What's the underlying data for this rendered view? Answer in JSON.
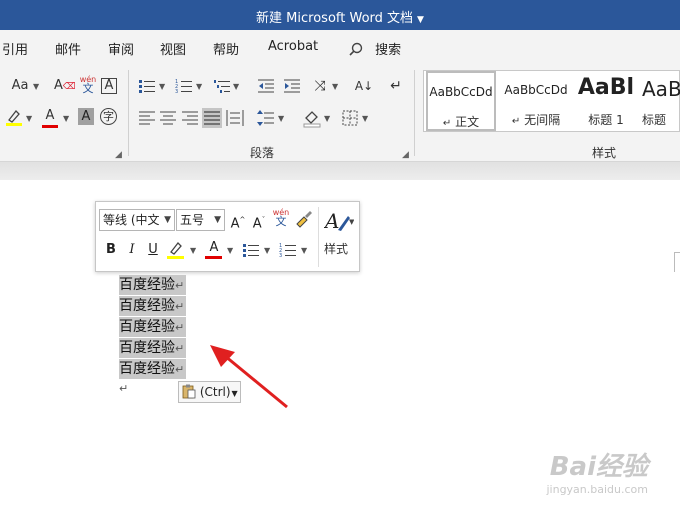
{
  "window": {
    "title": "新建 Microsoft Word 文档"
  },
  "menu": [
    "引用",
    "邮件",
    "审阅",
    "视图",
    "帮助",
    "Acrobat"
  ],
  "search": {
    "label": "搜索"
  },
  "ribbon": {
    "font_size_label": "Aa",
    "phonetic": {
      "top": "wén",
      "bottom": "文"
    },
    "groups": {
      "paragraph": "段落",
      "styles": "样式"
    },
    "styles": [
      {
        "sample": "AaBbCcDd",
        "name": "正文",
        "marker": "↵"
      },
      {
        "sample": "AaBbCcDd",
        "name": "无间隔",
        "marker": "↵"
      },
      {
        "sample": "AaBl",
        "name": "标题 1"
      },
      {
        "sample": "AaB",
        "name": "标题"
      }
    ]
  },
  "mini_toolbar": {
    "font_name": "等线 (中文",
    "font_size": "五号",
    "bold": "B",
    "italic": "I",
    "underline": "U",
    "styles_label": "样式",
    "phonetic": {
      "top": "wén",
      "bottom": "文"
    }
  },
  "document": {
    "lines": [
      "百度经验",
      "百度经验",
      "百度经验",
      "百度经验",
      "百度经验"
    ],
    "paragraph_mark": "↵"
  },
  "paste_options": {
    "label": "(Ctrl)"
  },
  "watermark": {
    "text": "Bai经验",
    "url": "jingyan.baidu.com"
  },
  "colors": {
    "titlebar": "#2b579a",
    "highlight": "#ffff00",
    "font_color": "#e00000",
    "arrow": "#e02020"
  }
}
